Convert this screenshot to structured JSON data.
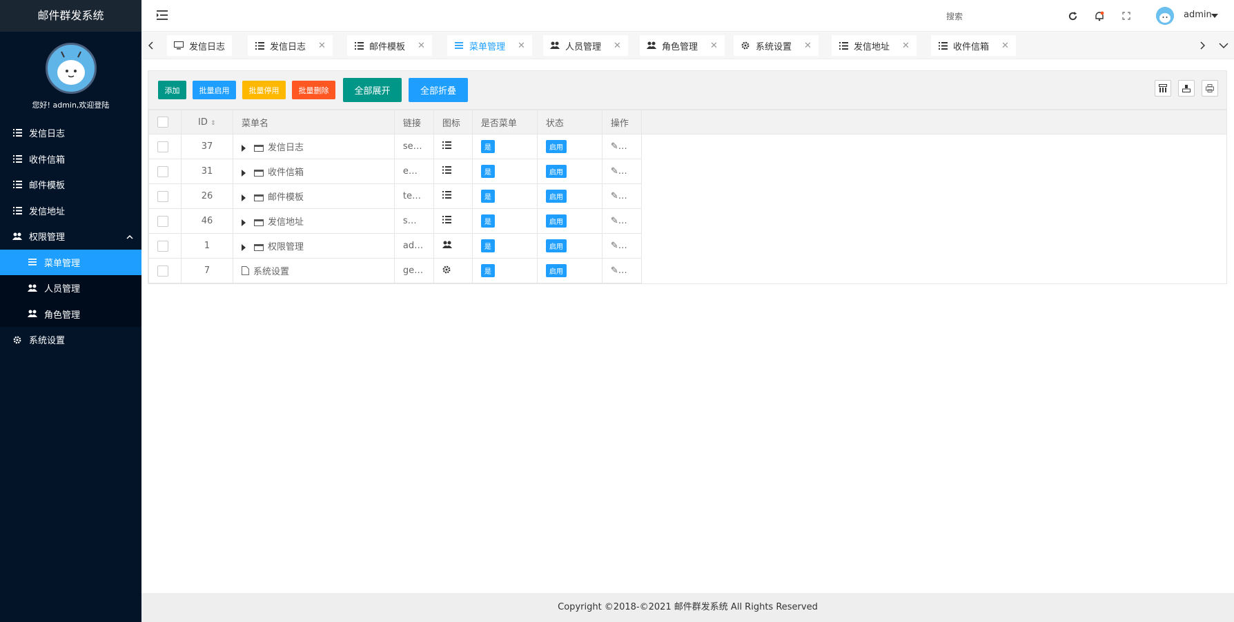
{
  "app": {
    "title": "邮件群发系统",
    "welcome": "您好! admin,欢迎登陆"
  },
  "sidebar": {
    "items": [
      {
        "label": "发信日志",
        "icon": "list-icon"
      },
      {
        "label": "收件信箱",
        "icon": "list-icon"
      },
      {
        "label": "邮件模板",
        "icon": "list-icon"
      },
      {
        "label": "发信地址",
        "icon": "list-icon"
      },
      {
        "label": "权限管理",
        "icon": "users-icon"
      },
      {
        "label": "菜单管理",
        "icon": "menu-icon"
      },
      {
        "label": "人员管理",
        "icon": "users-icon"
      },
      {
        "label": "角色管理",
        "icon": "users-icon"
      },
      {
        "label": "系统设置",
        "icon": "gear-icon"
      }
    ]
  },
  "header": {
    "search_label": "搜索",
    "user_name": "admin"
  },
  "tabs": [
    {
      "label": "发信日志",
      "icon": "monitor-icon"
    },
    {
      "label": "发信日志",
      "icon": "list-icon"
    },
    {
      "label": "邮件模板",
      "icon": "list-icon"
    },
    {
      "label": "菜单管理",
      "icon": "menu-icon"
    },
    {
      "label": "人员管理",
      "icon": "users-icon"
    },
    {
      "label": "角色管理",
      "icon": "users-icon"
    },
    {
      "label": "系统设置",
      "icon": "gear-icon"
    },
    {
      "label": "发信地址",
      "icon": "list-icon"
    },
    {
      "label": "收件信箱",
      "icon": "list-icon"
    }
  ],
  "toolbar": {
    "add": "添加",
    "batch_enable": "批量启用",
    "batch_disable": "批量停用",
    "batch_delete": "批量删除",
    "expand_all": "全部展开",
    "collapse_all": "全部折叠",
    "colors": {
      "add": "#009688",
      "batch_enable": "#1e9fff",
      "batch_disable": "#ffb800",
      "batch_delete": "#ff5722",
      "expand_all": "#009688",
      "collapse_all": "#1e9fff"
    }
  },
  "table": {
    "headers": [
      "ID",
      "菜单名",
      "链接",
      "图标",
      "是否菜单",
      "状态",
      "操作"
    ],
    "rows": [
      {
        "id": "37",
        "name": "发信日志",
        "link": "se…",
        "icon": "list-icon",
        "is_menu": "是",
        "status": "启用",
        "op": "…"
      },
      {
        "id": "31",
        "name": "收件信箱",
        "link": "e…",
        "icon": "list-icon",
        "is_menu": "是",
        "status": "启用",
        "op": "…"
      },
      {
        "id": "26",
        "name": "邮件模板",
        "link": "te…",
        "icon": "list-icon",
        "is_menu": "是",
        "status": "启用",
        "op": "…"
      },
      {
        "id": "46",
        "name": "发信地址",
        "link": "s…",
        "icon": "list-icon",
        "is_menu": "是",
        "status": "启用",
        "op": "…"
      },
      {
        "id": "1",
        "name": "权限管理",
        "link": "ad…",
        "icon": "users-icon",
        "is_menu": "是",
        "status": "启用",
        "op": "…"
      },
      {
        "id": "7",
        "name": "系统设置",
        "link": "ge…",
        "icon": "gear-icon",
        "is_menu": "是",
        "status": "启用",
        "op": "…"
      }
    ]
  },
  "footer": {
    "copyright": "Copyright ©2018-©2021 邮件群发系统 All Rights Reserved"
  }
}
